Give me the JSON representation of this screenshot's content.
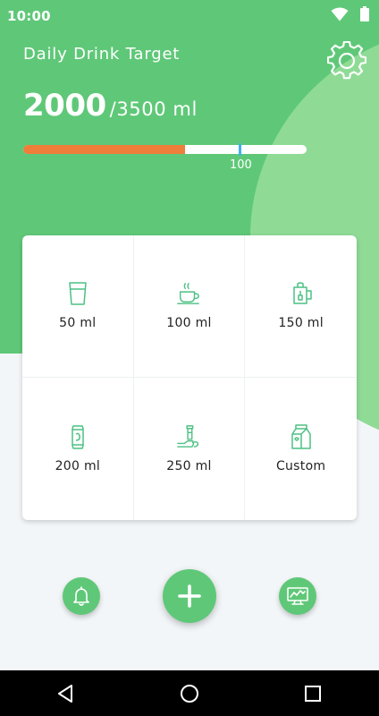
{
  "status_bar": {
    "time": "10:00",
    "icons": [
      "wifi-icon",
      "battery-icon"
    ]
  },
  "header": {
    "title": "Daily Drink Target",
    "current_amount": "2000",
    "target_amount": "/3500 ml",
    "settings_icon": "gear-icon"
  },
  "progress": {
    "current_ml": 2000,
    "target_ml": 3500,
    "fraction": 0.571,
    "marker_label": "100"
  },
  "cups": [
    {
      "label": "50 ml",
      "icon": "water-glass-icon"
    },
    {
      "label": "100 ml",
      "icon": "coffee-cup-icon"
    },
    {
      "label": "150 ml",
      "icon": "tea-mug-icon"
    },
    {
      "label": "200 ml",
      "icon": "soda-can-icon"
    },
    {
      "label": "250 ml",
      "icon": "juice-bottle-icon"
    },
    {
      "label": "Custom",
      "icon": "milk-carton-icon"
    }
  ],
  "actions": {
    "left": "bell-icon",
    "center": "plus-icon",
    "right": "chart-monitor-icon"
  },
  "colors": {
    "primary_green": "#5fc878",
    "light_green": "#8fdb96",
    "progress_fill": "#ee7e3a",
    "marker": "#3fb3e3",
    "icon_green": "#4cc083"
  },
  "nav": {
    "icons": [
      "back-icon",
      "home-icon",
      "recents-icon"
    ]
  }
}
